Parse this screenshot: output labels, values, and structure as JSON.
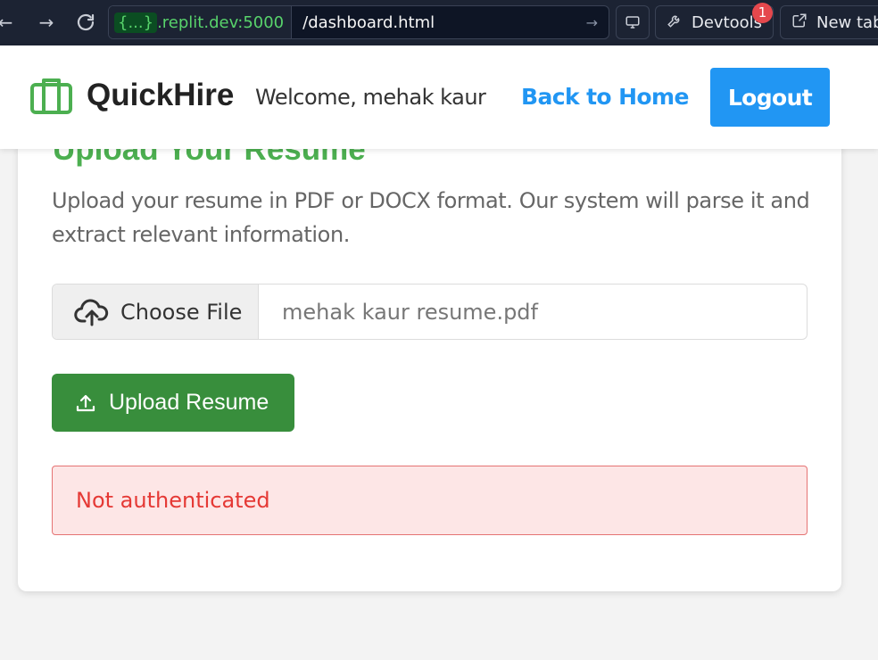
{
  "browser": {
    "back_icon": "arrow-left-icon",
    "forward_icon": "arrow-right-icon",
    "reload_icon": "reload-icon",
    "url_badge": "{...}",
    "url_domain": ".replit.dev:5000",
    "url_path": "/dashboard.html",
    "devtools_label": "Devtools",
    "devtools_badge": "1",
    "newtab_label": "New tab"
  },
  "header": {
    "brand": "QuickHire",
    "welcome": "Welcome, mehak kaur",
    "back_link": "Back to Home",
    "logout": "Logout"
  },
  "upload": {
    "title": "Upload Your Resume",
    "description": "Upload your resume in PDF or DOCX format. Our system will parse it and extract relevant information.",
    "choose_file": "Choose File",
    "file_name": "mehak kaur resume.pdf",
    "upload_button": "Upload Resume"
  },
  "alert": {
    "message": "Not authenticated"
  },
  "colors": {
    "accent_blue": "#2196f3",
    "accent_green": "#4caf50",
    "button_green": "#388e3c",
    "error_red": "#e53935"
  }
}
